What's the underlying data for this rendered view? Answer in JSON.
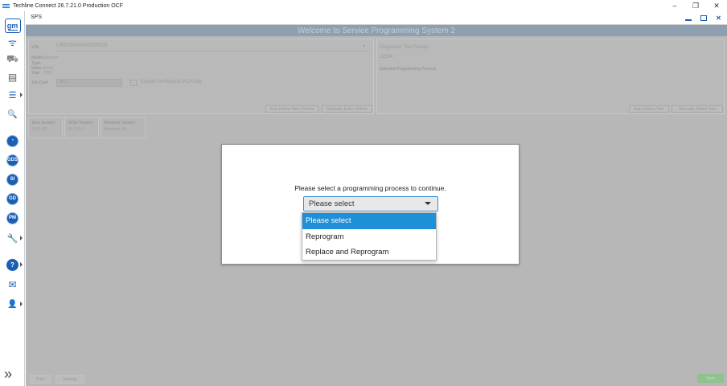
{
  "os": {
    "title": "Techline Connect 26.7.21.0 Production OCF",
    "minimize": "–",
    "restore": "❐",
    "close": "✕"
  },
  "sidebar": {
    "logo": "gm",
    "items": [
      {
        "icon": "wifi-icon",
        "glyph": "ᯤ"
      },
      {
        "icon": "truck-icon",
        "glyph": "⛟"
      },
      {
        "icon": "document-icon",
        "glyph": "▤"
      },
      {
        "icon": "list-icon",
        "glyph": "☰"
      },
      {
        "icon": "search-icon",
        "glyph": "🔍"
      },
      {
        "icon": "gauge-icon",
        "glyph": "◔"
      },
      {
        "icon": "gds-icon",
        "glyph": "GDS"
      },
      {
        "icon": "si-icon",
        "glyph": "SI"
      },
      {
        "icon": "gd-icon",
        "glyph": "GD"
      },
      {
        "icon": "pm-icon",
        "glyph": "PM"
      },
      {
        "icon": "wrench-icon",
        "glyph": "🔧"
      },
      {
        "icon": "help-icon",
        "glyph": "?"
      },
      {
        "icon": "mail-icon",
        "glyph": "✉"
      },
      {
        "icon": "user-icon",
        "glyph": "👤"
      }
    ],
    "expand": "»"
  },
  "window": {
    "title": "SPS",
    "welcome": "Welcome to Service Programming System 2"
  },
  "vehicle": {
    "vin_label": "VIN:",
    "vin_value": "LRBFZSR40MD000029",
    "model_label": "Model:",
    "model_value": "Envision",
    "type_label": "Type:",
    "type_value": "",
    "make_label": "Make:",
    "make_value": "Buick",
    "year_label": "Year:",
    "year_value": "2021",
    "jobcard_label": "Job Card:",
    "jobcard_value": "test",
    "verification_label": "Enable Verification PCI Data",
    "auto_detect_vehicle": "Auto Detect New Vehicle",
    "manual_vehicle": "Manually Enter Vehicle"
  },
  "tool": {
    "status": "Diagnostic Tool Ready!",
    "id": "J2534",
    "process_label": "Selected Programming Process",
    "auto_detect_tool": "Auto Detect Tool",
    "manual_tool": "Manually Select Tool"
  },
  "versions": [
    {
      "label": "Java Version:",
      "value": "1.8.0_92"
    },
    {
      "label": "SPS2 Version:",
      "value": "26.7.21.0"
    },
    {
      "label": "Windows Version:",
      "value": "Windows 10"
    }
  ],
  "modal": {
    "message": "Please select a programming process to continue.",
    "selected": "Please select",
    "options": [
      "Please select",
      "Reprogram",
      "Replace and Reprogram"
    ]
  },
  "footer": {
    "print": "Print",
    "settings": "Settings",
    "next": "Next"
  }
}
